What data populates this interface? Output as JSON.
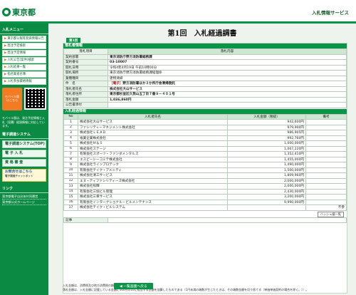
{
  "header": {
    "logo_text": "東京都",
    "service_title": "入札情報サービス"
  },
  "sidebar": {
    "menu_heading": "入札メニュー",
    "menu_items": [
      "東京都公報等発表情報公告",
      "発注予定検索",
      "発注予定情報",
      "入札公告(案件)検索",
      "入札結果一覧",
      "指名業者名簿",
      "入札参加資格情報"
    ],
    "mobile_label": "モバイル版",
    "mobile_sub": "はこちら",
    "mobile_note": "モバイル版は、発注予定情報と入札（見積）経過情報に対応しています。",
    "links_heading": "電子調達システム",
    "buttons": [
      "電子調達システム(TOP)",
      "電 子 入 札",
      "資 格 審 査"
    ],
    "inquiry_line1": "お問合せはこちら",
    "inquiry_line2": "電子調達チャットボット",
    "footer_heading": "リンク",
    "footer_links": [
      "東京都電子自治体共同運営",
      "東京都公式ホームページ"
    ]
  },
  "main": {
    "title": "第1回　入札経過調書",
    "round_tab": "第1回",
    "info_section": "落札者情報",
    "info_header": [
      "落札項目",
      "落札内容"
    ],
    "info_rows": [
      {
        "label": "契約部署",
        "value": "東京消防庁野方消防署総務課",
        "bold": true
      },
      {
        "label": "契約番号",
        "value": "03-10007",
        "bold": true
      },
      {
        "label": "開札日時",
        "value": "令和4年4月19日 午前10時00分",
        "bold": false
      },
      {
        "label": "開札場所",
        "value": "東京消防庁野方消防署総務課経理係",
        "bold": false
      },
      {
        "label": "業種種目",
        "value": "建物清掃",
        "bold": false
      },
      {
        "label": "件　名",
        "tag": "［電子］",
        "value": "野方消防署ほか３か所庁舎清掃委託",
        "bold": true
      },
      {
        "label": "落札者氏名",
        "value": "株式会社大山サービス",
        "bold": true
      },
      {
        "label": "落札者住所",
        "value": "東京都杉並区久我山五丁目７番９－４０１号",
        "bold": true
      },
      {
        "label": "落札金額",
        "value": "1,036,860円",
        "bold": true
      },
      {
        "label": "公告書添付",
        "value": "",
        "bold": false
      }
    ],
    "bid_section": "入札経過情報",
    "bid_header": [
      "No",
      "入札者氏名",
      "入札金額（税抜）",
      "備考"
    ],
    "bids": [
      {
        "no": "1",
        "name": "株式会社大山サービス",
        "amount": "942,600円",
        "note": ""
      },
      {
        "no": "2",
        "name": "ファシリティーマネジメント株式会社",
        "amount": "979,900円",
        "note": ""
      },
      {
        "no": "3",
        "name": "株式会社ＬＥＡＤ",
        "amount": "986,905円",
        "note": ""
      },
      {
        "no": "4",
        "name": "福業企業株式会社",
        "amount": "992,760円",
        "note": ""
      },
      {
        "no": "5",
        "name": "株式会社Ｍ＆Ｓ",
        "amount": "1,000,000円",
        "note": ""
      },
      {
        "no": "6",
        "name": "株式会社ステージ",
        "amount": "1,067,220円",
        "note": ""
      },
      {
        "no": "7",
        "name": "有限会社スポーツ・ファンダメンタルズ",
        "amount": "1,352,410円",
        "note": ""
      },
      {
        "no": "8",
        "name": "エスピーシーコミテ株式会社",
        "amount": "1,455,000円",
        "note": ""
      },
      {
        "no": "9",
        "name": "株式会社ラインプロテック",
        "amount": "1,490,000円",
        "note": ""
      },
      {
        "no": "10",
        "name": "有限会社テイク・アメニティ",
        "amount": "1,500,000円",
        "note": ""
      },
      {
        "no": "11",
        "name": "株式会社清工サービス",
        "amount": "1,809,960円",
        "note": ""
      },
      {
        "no": "12",
        "name": "エヌ・ティファシリティーズ株式会社",
        "amount": "2,000,000円",
        "note": ""
      },
      {
        "no": "13",
        "name": "株式会社照輝",
        "amount": "2,000,000円",
        "note": ""
      },
      {
        "no": "14",
        "name": "有限会社三協ビル管理",
        "amount": "2,430,000円",
        "note": ""
      },
      {
        "no": "15",
        "name": "株式会社三幸サービス",
        "amount": "3,200,000円",
        "note": ""
      },
      {
        "no": "16",
        "name": "有限会社インターナショナル・ビルメンテナンス",
        "amount": "9,990,000円",
        "note": ""
      },
      {
        "no": "17",
        "name": "株式会社テイク・ビルシステム",
        "amount": "",
        "note": "不参"
      }
    ],
    "history_button": "ハッシュ値一覧",
    "remarks_label": "記事",
    "notes": [
      "入札金額は、消費税及び地方消費税の額を含まない金額である。",
      "落札金額は、入札金額に記載している金額に100分の10に相当する金額を加算したものである（1円未満の端数が生じたときは、その端数金額を切り捨てる（単価単価契約の場合を除く。））。"
    ],
    "back_button": "一覧画面へ戻る"
  }
}
